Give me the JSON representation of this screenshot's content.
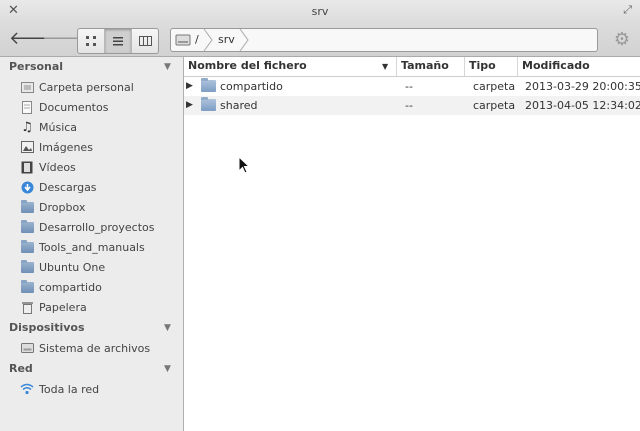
{
  "window": {
    "title": "srv"
  },
  "toolbar": {
    "back_icon": "arrow-left-icon",
    "forward_icon": "arrow-right-icon",
    "view_modes": [
      "icon-view",
      "list-view",
      "column-view"
    ],
    "active_view": "list-view",
    "breadcrumbs": [
      "/",
      "srv"
    ],
    "settings_icon": "gear-icon"
  },
  "sidebar": {
    "sections": [
      {
        "title": "Personal",
        "items": [
          {
            "label": "Carpeta personal",
            "icon": "home-folder-icon"
          },
          {
            "label": "Documentos",
            "icon": "documents-icon"
          },
          {
            "label": "Música",
            "icon": "music-icon"
          },
          {
            "label": "Imágenes",
            "icon": "pictures-icon"
          },
          {
            "label": "Vídeos",
            "icon": "videos-icon"
          },
          {
            "label": "Descargas",
            "icon": "downloads-icon"
          },
          {
            "label": "Dropbox",
            "icon": "folder-icon"
          },
          {
            "label": "Desarrollo_proyectos",
            "icon": "folder-icon"
          },
          {
            "label": "Tools_and_manuals",
            "icon": "folder-icon"
          },
          {
            "label": "Ubuntu One",
            "icon": "folder-icon"
          },
          {
            "label": "compartido",
            "icon": "folder-icon"
          },
          {
            "label": "Papelera",
            "icon": "trash-icon"
          }
        ]
      },
      {
        "title": "Dispositivos",
        "items": [
          {
            "label": "Sistema de archivos",
            "icon": "drive-icon"
          }
        ]
      },
      {
        "title": "Red",
        "items": [
          {
            "label": "Toda la red",
            "icon": "network-icon"
          }
        ]
      }
    ]
  },
  "file_list": {
    "columns": [
      "Nombre del fichero",
      "Tamaño",
      "Tipo",
      "Modificado"
    ],
    "rows": [
      {
        "name": "compartido",
        "size": "--",
        "type": "carpeta",
        "modified": "2013-03-29 20:00:35"
      },
      {
        "name": "shared",
        "size": "--",
        "type": "carpeta",
        "modified": "2013-04-05 12:34:02"
      }
    ]
  }
}
